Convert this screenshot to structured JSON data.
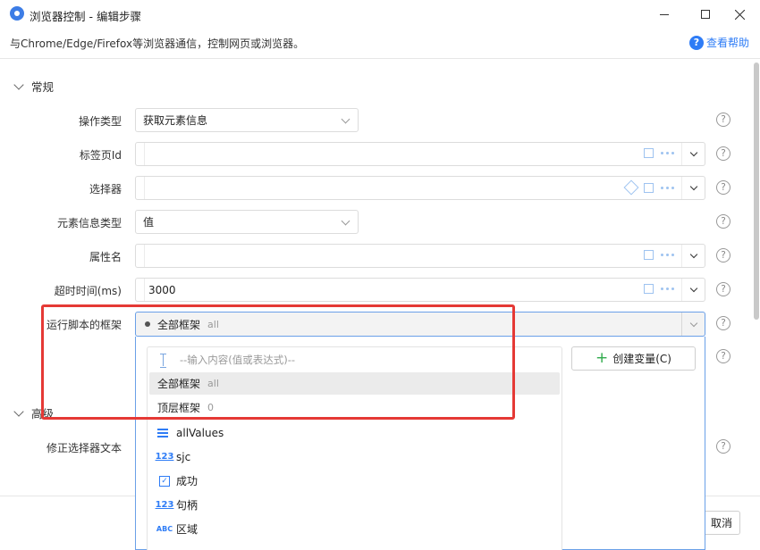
{
  "window": {
    "title": "浏览器控制 - 编辑步骤",
    "subtitle": "与Chrome/Edge/Firefox等浏览器通信，控制网页或浏览器。",
    "help_label": "查看帮助"
  },
  "sections": {
    "general": "常规",
    "advanced": "高级"
  },
  "form": {
    "operation_type": {
      "label": "操作类型",
      "value": "获取元素信息"
    },
    "tab_id": {
      "label": "标签页Id",
      "value": ""
    },
    "selector": {
      "label": "选择器",
      "value": ""
    },
    "element_info_type": {
      "label": "元素信息类型",
      "value": "值"
    },
    "attribute_name": {
      "label": "属性名",
      "value": ""
    },
    "timeout": {
      "label": "超时时间(ms)",
      "value": "3000"
    },
    "frame": {
      "label": "运行脚本的框架",
      "value": "全部框架",
      "hint": "all"
    },
    "fix_selector_text": {
      "label": "修正选择器文本"
    }
  },
  "dropdown": {
    "search_placeholder": "--输入内容(值或表达式)--",
    "options": [
      {
        "label": "全部框架",
        "hint": "all"
      },
      {
        "label": "顶层框架",
        "hint": "0"
      }
    ],
    "variables": [
      {
        "icon": "list-icon",
        "name": "allValues"
      },
      {
        "icon": "number-icon",
        "icon_text": "123",
        "name": "sjc"
      },
      {
        "icon": "boolean-icon",
        "icon_text": "✓",
        "name": "成功"
      },
      {
        "icon": "number-icon",
        "icon_text": "123",
        "name": "句柄"
      },
      {
        "icon": "text-icon",
        "icon_text": "ABC",
        "name": "区域"
      }
    ],
    "create_variable_label": "创建变量(C)"
  },
  "footer": {
    "cancel_label": "取消"
  },
  "colors": {
    "accent": "#2e7cf6",
    "highlight": "#e53935",
    "plus": "#2faa4b"
  }
}
